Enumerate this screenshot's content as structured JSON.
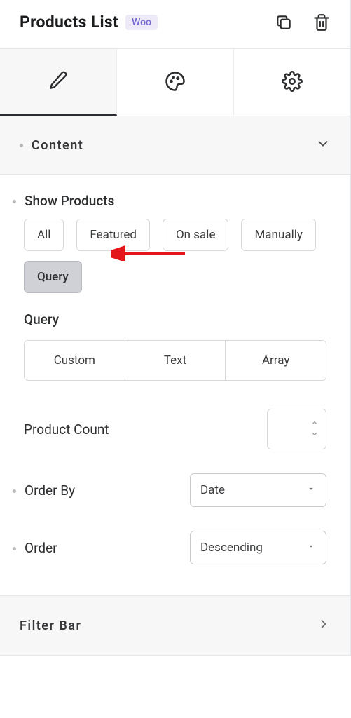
{
  "header": {
    "title": "Products List",
    "badge": "Woo"
  },
  "sections": {
    "content": {
      "label": "Content"
    },
    "filterBar": {
      "label": "Filter Bar"
    }
  },
  "showProducts": {
    "label": "Show Products",
    "options": {
      "all": "All",
      "featured": "Featured",
      "onsale": "On sale",
      "manually": "Manually",
      "query": "Query"
    },
    "selected": "query"
  },
  "queryType": {
    "label": "Query",
    "options": {
      "custom": "Custom",
      "text": "Text",
      "array": "Array"
    }
  },
  "productCount": {
    "label": "Product Count",
    "value": ""
  },
  "orderBy": {
    "label": "Order By",
    "value": "Date"
  },
  "order": {
    "label": "Order",
    "value": "Descending"
  }
}
